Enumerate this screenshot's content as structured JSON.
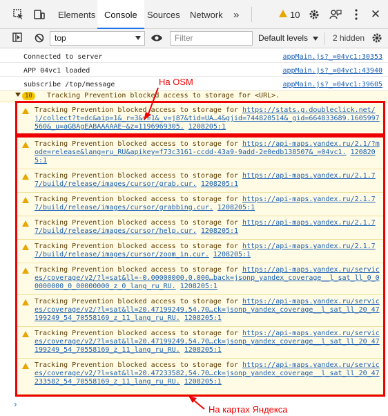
{
  "tabs": [
    "Elements",
    "Console",
    "Sources",
    "Network"
  ],
  "more_tabs": "»",
  "warning_count": "10",
  "toolbar": {
    "context": "top",
    "filter_placeholder": "Filter",
    "levels": "Default levels",
    "hidden": "2 hidden"
  },
  "logs": [
    {
      "text": "Connected to server",
      "source": "appMain.js?_=04vc1:30353"
    },
    {
      "text": "APP 04vc1 loaded",
      "source": "appMain.js?_=04vc1:43940"
    },
    {
      "text": "subscribe /top/message",
      "source": "appMain.js?_=04vc1:39605"
    }
  ],
  "group": {
    "count": "10",
    "text": "Tracking Prevention blocked access to storage for <URL>."
  },
  "warnings": [
    {
      "prefix": "Tracking Prevention blocked access to storage for ",
      "url": "https://stats.g.doubleclick.net/j/collect?t=dc&aip=1&_r=3&v=1&_v=j87&tid=UA…4&gjid=744820514&_gid=664833689.1605997560&_u=aGBAgEABAAAAAE~&z=1196969305.",
      "source": "1208205:1"
    },
    {
      "prefix": "Tracking Prevention blocked access to storage for ",
      "url": "https://api-maps.yandex.ru/2.1/?mode=release&lang=ru_RU&apikey=f73c3161-ccdd-43a9-9add-2e0edb138507&_=04vc1.",
      "source": "1208205:1"
    },
    {
      "prefix": "Tracking Prevention blocked access to storage for ",
      "url": "https://api-maps.yandex.ru/2.1.77/build/release/images/cursor/grab.cur.",
      "source": "1208205:1"
    },
    {
      "prefix": "Tracking Prevention blocked access to storage for ",
      "url": "https://api-maps.yandex.ru/2.1.77/build/release/images/cursor/grabbing.cur.",
      "source": "1208205:1"
    },
    {
      "prefix": "Tracking Prevention blocked access to storage for ",
      "url": "https://api-maps.yandex.ru/2.1.77/build/release/images/cursor/help.cur.",
      "source": "1208205:1"
    },
    {
      "prefix": "Tracking Prevention blocked access to storage for ",
      "url": "https://api-maps.yandex.ru/2.1.77/build/release/images/cursor/zoom_in.cur.",
      "source": "1208205:1"
    },
    {
      "prefix": "Tracking Prevention blocked access to storage for ",
      "url": "https://api-maps.yandex.ru/services/coverage/v2/?l=sat&ll=-0.00000000,0.000…back=jsonp_yandex_coverage__l_sat_ll_0_00000000_0_00000000_z_0_lang_ru_RU.",
      "source": "1208205:1"
    },
    {
      "prefix": "Tracking Prevention blocked access to storage for ",
      "url": "https://api-maps.yandex.ru/services/coverage/v2/?l=sat&ll=20.47199249,54.70…ck=jsonp_yandex_coverage__l_sat_ll_20_47199249_54_70558169_z_11_lang_ru_RU.",
      "source": "1208205:1"
    },
    {
      "prefix": "Tracking Prevention blocked access to storage for ",
      "url": "https://api-maps.yandex.ru/services/coverage/v2/?l=sat&ll=20.47199249,54.70…ck=jsonp_yandex_coverage__l_sat_ll_20_47199249_54_70558169_z_11_lang_ru_RU.",
      "source": "1208205:1"
    },
    {
      "prefix": "Tracking Prevention blocked access to storage for ",
      "url": "https://api-maps.yandex.ru/services/coverage/v2/?l=sat&ll=20.47233582,54.70…ck=jsonp_yandex_coverage__l_sat_ll_20_47233582_54_70558169_z_11_lang_ru_RU.",
      "source": "1208205:1"
    }
  ],
  "annotations": {
    "osm": "На OSM",
    "yandex": "На картах Яндекса"
  },
  "prompt": "›",
  "colors": {
    "accent": "#1a73e8",
    "warning_bg": "#fffbe5",
    "annotation": "#e00000"
  }
}
